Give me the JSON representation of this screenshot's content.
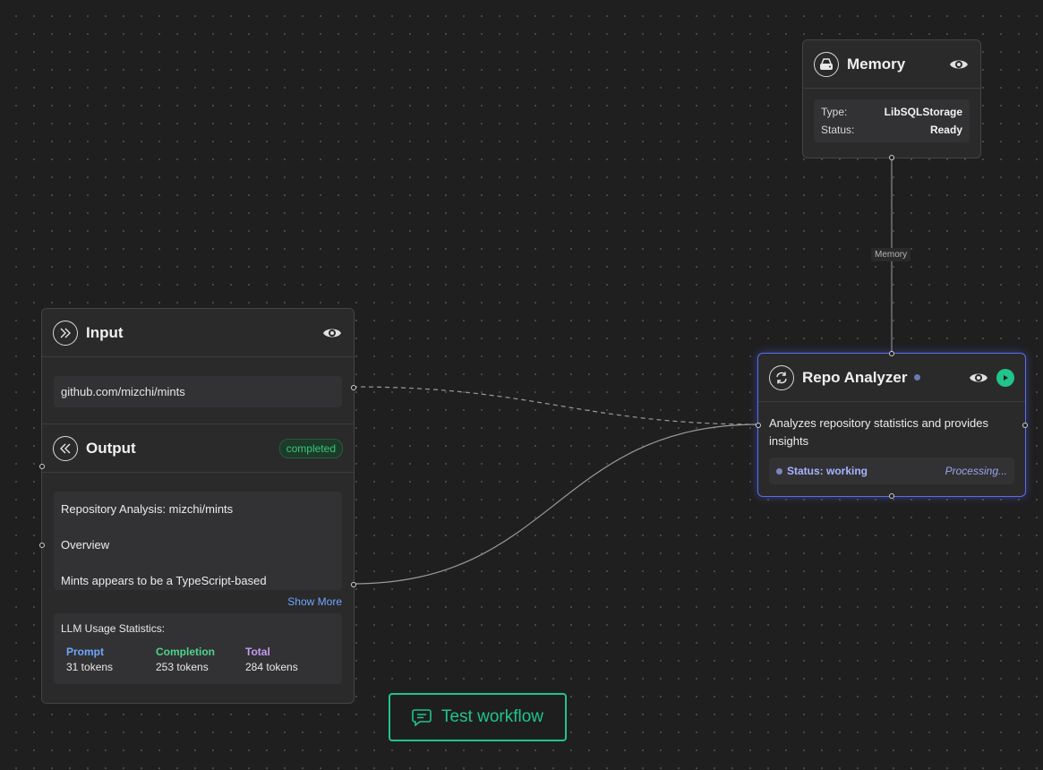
{
  "memory_node": {
    "title": "Memory",
    "rows": [
      {
        "key": "Type:",
        "value": "LibSQLStorage"
      },
      {
        "key": "Status:",
        "value": "Ready"
      }
    ]
  },
  "memory_edge_label": "Memory",
  "input_node": {
    "title": "Input",
    "value": "github.com/mizchi/mints"
  },
  "output_node": {
    "title": "Output",
    "status_badge": "completed",
    "text_lines": [
      "Repository Analysis: mizchi/mints",
      "Overview",
      "Mints appears to be a TypeScript-based"
    ],
    "show_more": "Show More",
    "usage": {
      "title": "LLM Usage Statistics:",
      "prompt_label": "Prompt",
      "prompt_value": "31 tokens",
      "completion_label": "Completion",
      "completion_value": "253 tokens",
      "total_label": "Total",
      "total_value": "284 tokens"
    }
  },
  "agent_node": {
    "title": "Repo Analyzer",
    "description": "Analyzes repository statistics and provides insights",
    "status": "Status: working",
    "processing": "Processing..."
  },
  "test_button": {
    "label": "Test workflow"
  },
  "colors": {
    "accent_green": "#21c48b",
    "agent_border": "#5c6cf0",
    "prompt_blue": "#6ea6ff",
    "completion_green": "#4fd48a",
    "total_purple": "#c69af0",
    "status_blue": "#a7b3ff"
  },
  "icons": [
    "database-icon",
    "eye-icon",
    "chevrons-right-icon",
    "chevrons-left-icon",
    "refresh-icon",
    "play-icon",
    "message-icon",
    "status-dot-icon"
  ]
}
